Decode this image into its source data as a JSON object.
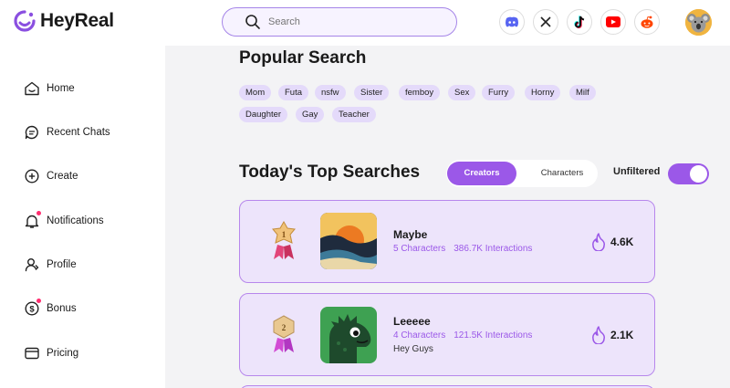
{
  "brand": {
    "name": "HeyReal",
    "accent": "#9b58e8"
  },
  "search": {
    "placeholder": "Search"
  },
  "socials": [
    {
      "icon": "discord-icon",
      "color": "#5865f2"
    },
    {
      "icon": "x-icon",
      "color": "#000000"
    },
    {
      "icon": "tiktok-icon",
      "color": "#000000"
    },
    {
      "icon": "youtube-icon",
      "color": "#ff0000"
    },
    {
      "icon": "reddit-icon",
      "color": "#ff4500"
    }
  ],
  "sidebar": {
    "items": [
      {
        "label": "Home",
        "icon": "home-icon"
      },
      {
        "label": "Recent Chats",
        "icon": "chat-icon"
      },
      {
        "label": "Create",
        "icon": "plus-circle-icon"
      },
      {
        "label": "Notifications",
        "icon": "bell-icon",
        "badge": true
      },
      {
        "label": "Profile",
        "icon": "user-icon"
      },
      {
        "label": "Bonus",
        "icon": "dollar-icon",
        "badge": true
      },
      {
        "label": "Pricing",
        "icon": "card-icon"
      }
    ]
  },
  "popular": {
    "title": "Popular Search",
    "tags": [
      "Mom",
      "Futa",
      "nsfw",
      "Sister",
      "femboy",
      "Sex",
      "Furry",
      "Horny",
      "Milf",
      "Daughter",
      "Gay",
      "Teacher"
    ]
  },
  "today": {
    "title": "Today's Top Searches",
    "tabs": {
      "creators": "Creators",
      "characters": "Characters",
      "active": "Creators"
    },
    "filter": {
      "label": "Unfiltered",
      "on": true
    }
  },
  "cards": [
    {
      "rank": "1",
      "name": "Maybe",
      "characters": "5 Characters",
      "interactions": "386.7K Interactions",
      "desc": "",
      "count": "4.6K"
    },
    {
      "rank": "2",
      "name": "Leeeee",
      "characters": "4 Characters",
      "interactions": "121.5K Interactions",
      "desc": "Hey Guys",
      "count": "2.1K"
    }
  ]
}
